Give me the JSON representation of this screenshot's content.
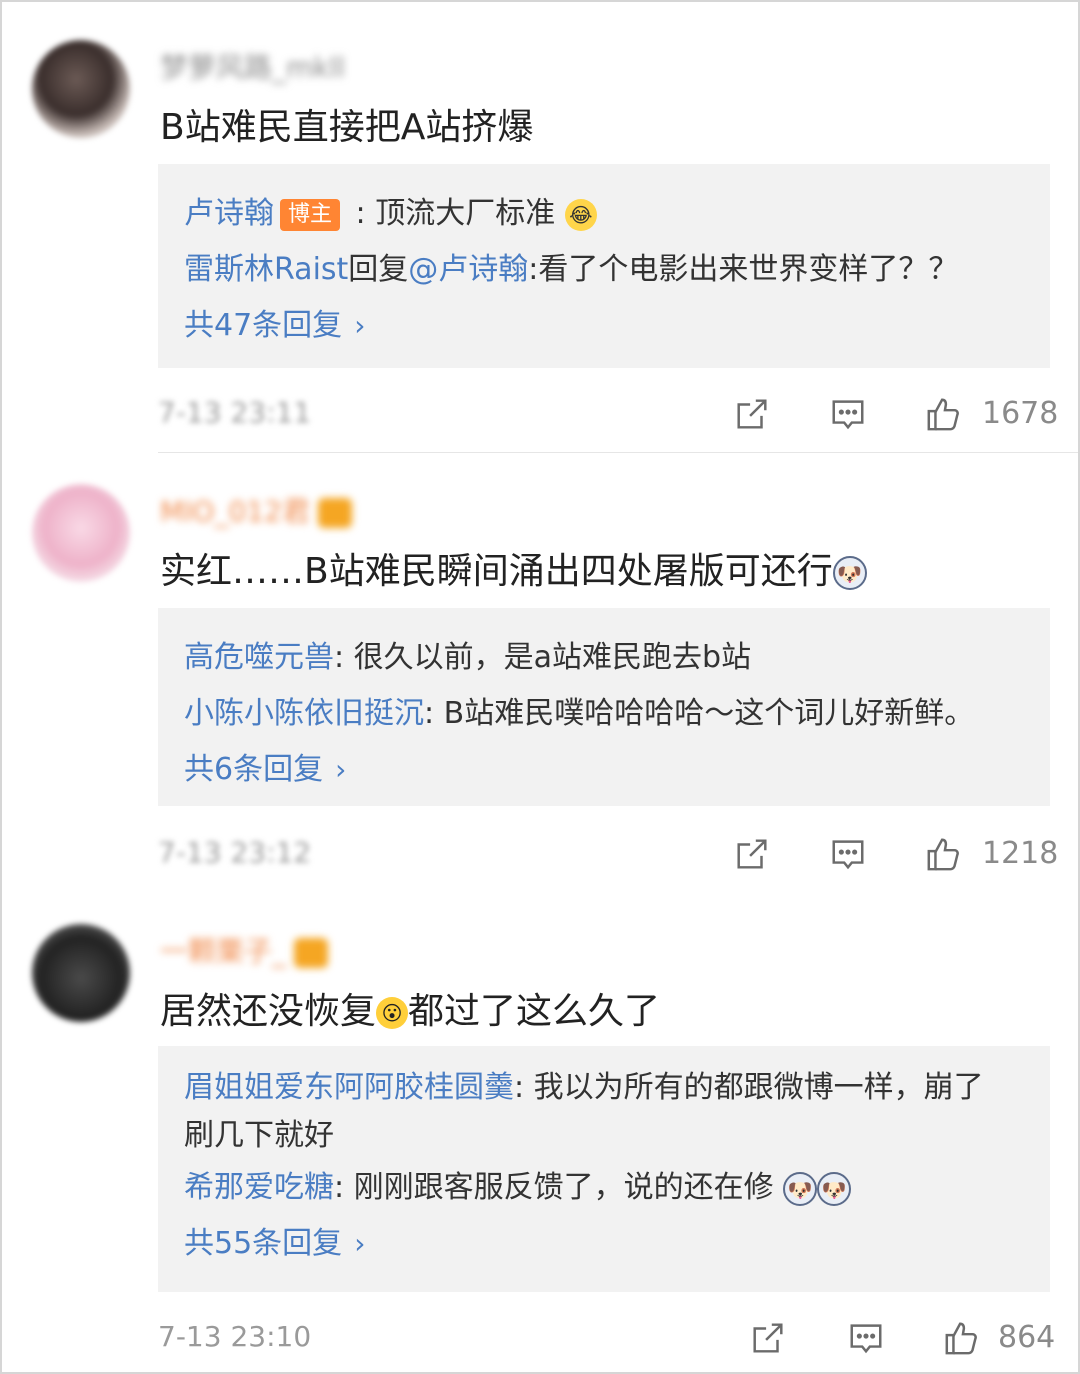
{
  "comments": [
    {
      "username": "梦萝风路_mkll",
      "text": "B站难民直接把A站挤爆",
      "replies": [
        {
          "name": "卢诗翰",
          "badge": "博主",
          "sep": " : ",
          "text": "顶流大厂标准",
          "emoji": "laugh-emoji"
        },
        {
          "name": "雷斯林Raist",
          "mid": "回复",
          "mention": "@卢诗翰",
          "sep": ":",
          "text": "看了个电影出来世界变样了？？"
        }
      ],
      "more": "共47条回复",
      "time": "7-13 23:11",
      "likes": "1678"
    },
    {
      "username": "MIO_012君",
      "text_main": "实红……B站难民瞬间涌出四处屠版可还行",
      "emoji": "doge-emoji",
      "replies": [
        {
          "name": "高危噬元兽",
          "sep": ": ",
          "text": "很久以前，是a站难民跑去b站"
        },
        {
          "name": "小陈小陈依旧挺沉",
          "sep": ": ",
          "text": "B站难民噗哈哈哈哈～这个词儿好新鲜。"
        }
      ],
      "more": "共6条回复",
      "time": "7-13 23:12",
      "likes": "1218"
    },
    {
      "username": "一颗栗子_",
      "text_a": "居然还没恢复",
      "emoji": "wonder-emoji",
      "text_b": "都过了这么久了",
      "replies": [
        {
          "name": "眉姐姐爱东阿阿胶桂圆羹",
          "sep": ": ",
          "text": "我以为所有的都跟微博一样，崩了刷几下就好"
        },
        {
          "name": "希那爱吃糖",
          "sep": ": ",
          "text": "刚刚跟客服反馈了，说的还在修"
        }
      ],
      "more": "共55条回复",
      "time": "7-13 23:10",
      "likes": "864"
    }
  ],
  "icons": {
    "share": "share-icon",
    "comment": "comment-icon",
    "like": "thumbs-up-icon",
    "chevron": "›"
  },
  "colors": {
    "link": "#4a7dc3",
    "badge": "#ff8533",
    "reply_bg": "#f2f2f2",
    "muted": "#8a8a8a"
  }
}
